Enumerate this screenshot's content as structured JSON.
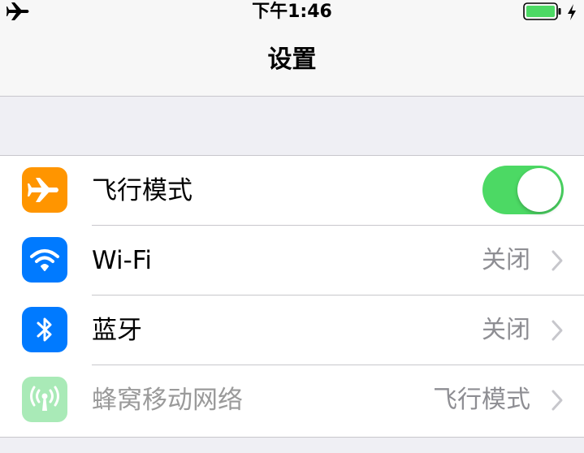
{
  "status_bar": {
    "time": "下午1:46",
    "icons": [
      "airplane-mode-icon",
      "battery-icon",
      "charging-bolt-icon"
    ],
    "battery_color": "#4cd964"
  },
  "nav": {
    "title": "设置"
  },
  "settings": [
    {
      "label": "飞行模式",
      "icon": "airplane-icon",
      "icon_color": "#ff9500",
      "control": "toggle",
      "toggle_on": true,
      "toggle_color": "#4cd964"
    },
    {
      "label": "Wi-Fi",
      "icon": "wifi-icon",
      "icon_color": "#007aff",
      "value": "关闭"
    },
    {
      "label": "蓝牙",
      "icon": "bluetooth-icon",
      "icon_color": "#007aff",
      "value": "关闭"
    },
    {
      "label": "蜂窝移动网络",
      "icon": "cellular-antenna-icon",
      "icon_color": "#a9eab7",
      "value": "飞行模式",
      "disabled": true
    }
  ]
}
